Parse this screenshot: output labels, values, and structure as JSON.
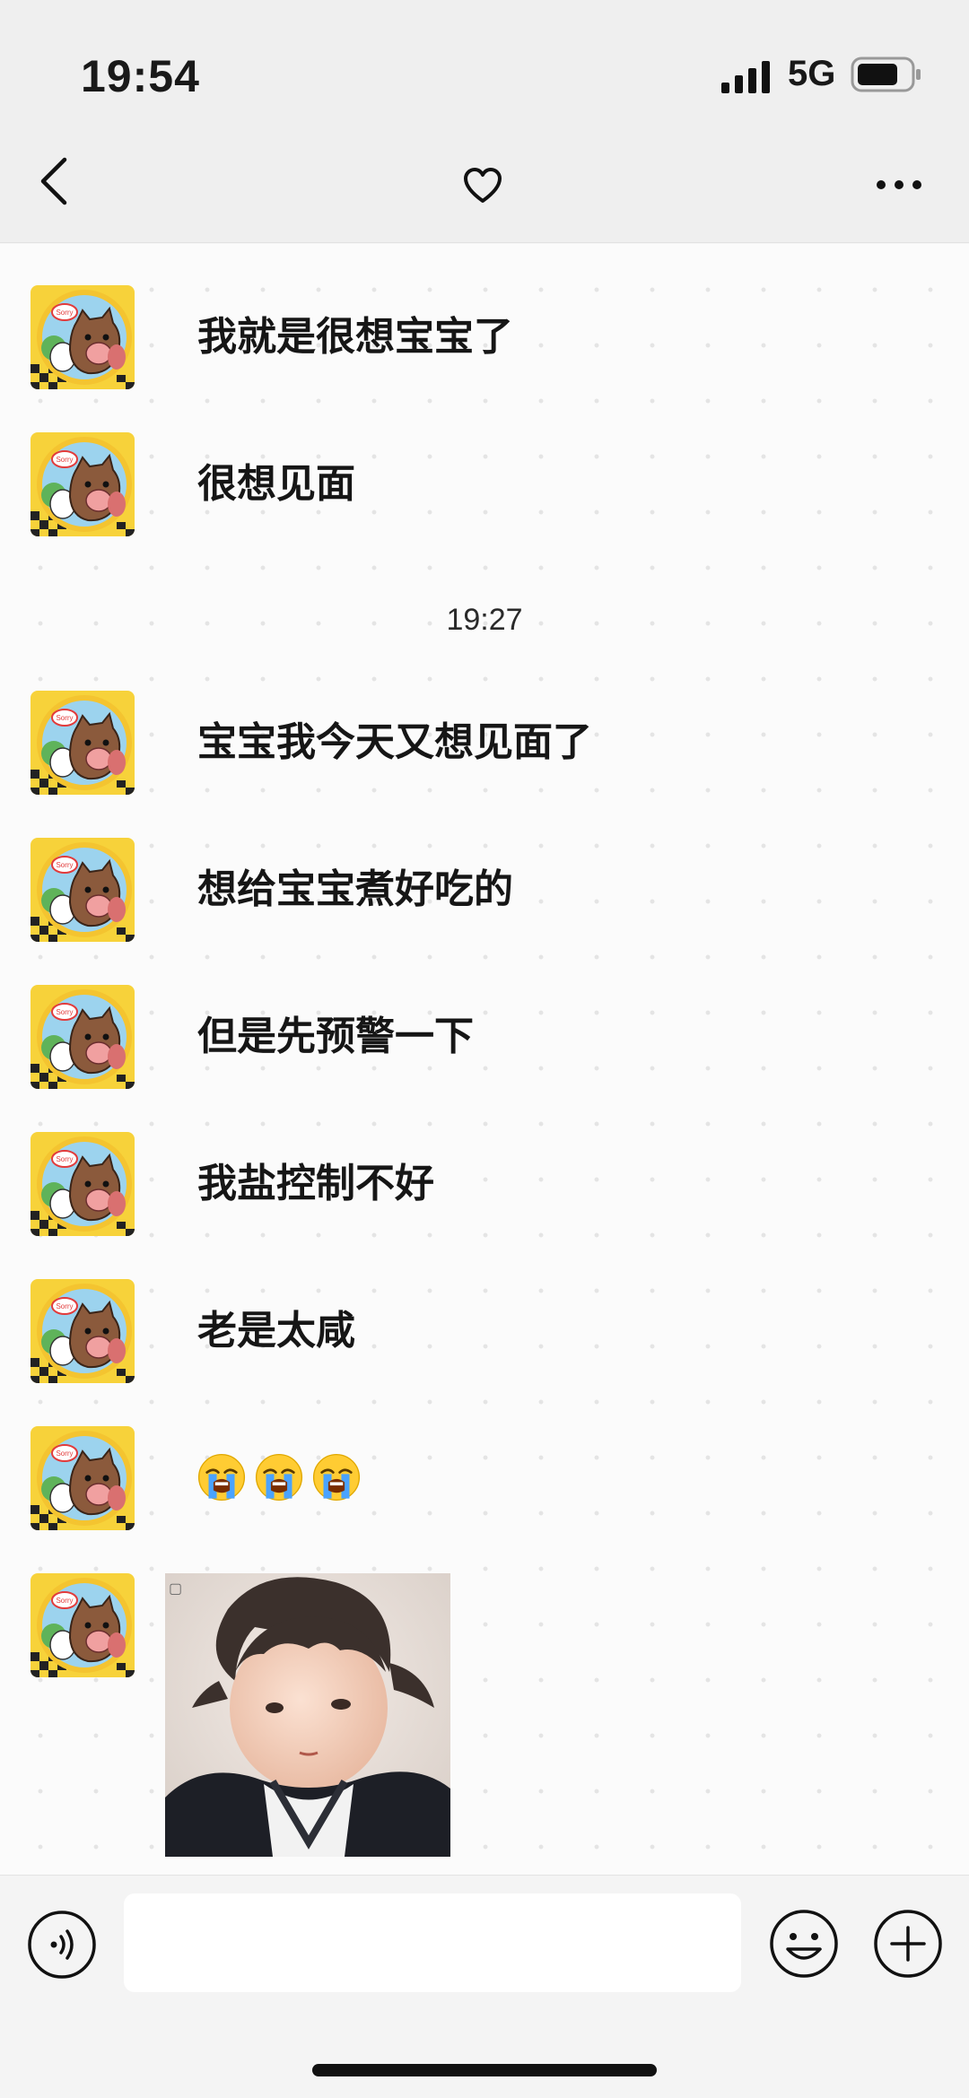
{
  "status_bar": {
    "time": "19:54",
    "network": "5G"
  },
  "nav": {
    "back_icon": "chevron-left-icon",
    "center_icon": "heart-icon",
    "more_icon": "more-dots-icon"
  },
  "chat": {
    "messages": [
      {
        "type": "text",
        "text": "我就是很想宝宝了"
      },
      {
        "type": "text",
        "text": "很想见面"
      },
      {
        "type": "timestamp",
        "text": "19:27"
      },
      {
        "type": "text",
        "text": "宝宝我今天又想见面了"
      },
      {
        "type": "text",
        "text": "想给宝宝煮好吃的"
      },
      {
        "type": "text",
        "text": "但是先预警一下"
      },
      {
        "type": "text",
        "text": "我盐控制不好"
      },
      {
        "type": "text",
        "text": "老是太咸"
      },
      {
        "type": "emoji",
        "emojis": [
          "loudly-crying-face",
          "loudly-crying-face",
          "loudly-crying-face"
        ]
      },
      {
        "type": "image",
        "description": "sticker-photo"
      }
    ]
  },
  "input_bar": {
    "voice_icon": "voice-icon",
    "input_value": "",
    "emoji_icon": "smiley-icon",
    "plus_icon": "plus-icon"
  },
  "colors": {
    "top_bg": "#efefef",
    "chat_bg": "#fbfbfb",
    "input_bg": "#f4f4f4"
  }
}
